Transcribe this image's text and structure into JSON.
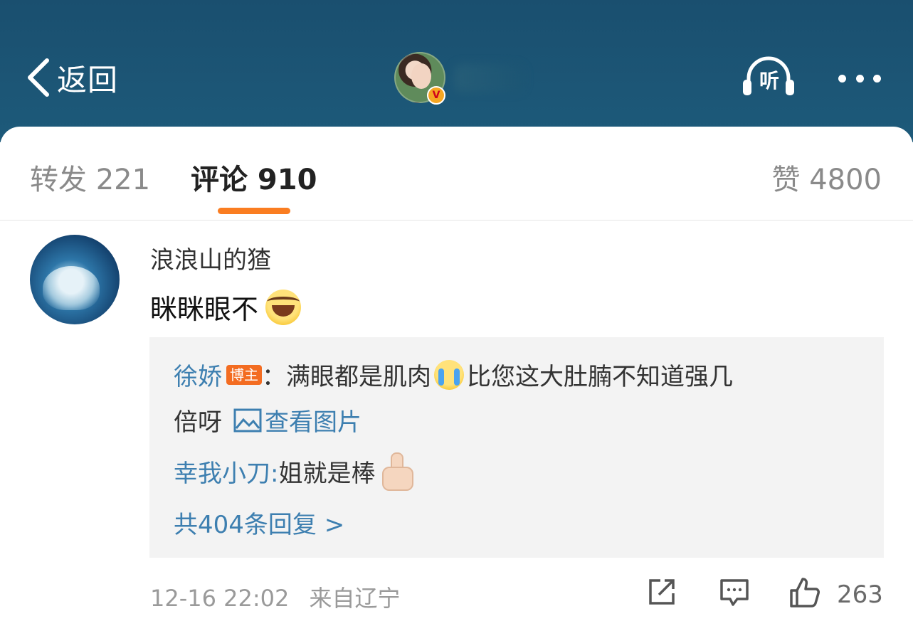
{
  "header": {
    "back_label": "返回",
    "verified_badge": "V",
    "listen_label": "听",
    "icons": {
      "back": "chevron-left-icon",
      "listen": "headphones-icon",
      "more": "more-dots-icon"
    }
  },
  "tabs": {
    "repost": "转发 221",
    "comment": "评论 910",
    "like": "赞 4800",
    "active_color": "#fa7d21"
  },
  "comment": {
    "username": "浪浪山的猹",
    "text": "眯眯眼不",
    "emoji": "laughing-tears-emoji",
    "replies": [
      {
        "name": "徐娇",
        "badge": "博主",
        "text_1": "：满眼都是肌肉",
        "emoji": "crying-emoji",
        "text_2": "比您这大肚腩不知道强几",
        "text_3": "倍呀",
        "view_pic": "查看图片"
      },
      {
        "name": "幸我小刀:",
        "text": " 姐就是棒",
        "emoji": "thumbs-up-emoji"
      }
    ],
    "total_replies": "共404条回复 >",
    "date": "12-16 22:02",
    "location": "来自辽宁",
    "like_count": "263"
  },
  "colors": {
    "header_bg": "#1d5a7a",
    "link_blue": "#3d7fb0",
    "badge_orange": "#f36c21"
  }
}
